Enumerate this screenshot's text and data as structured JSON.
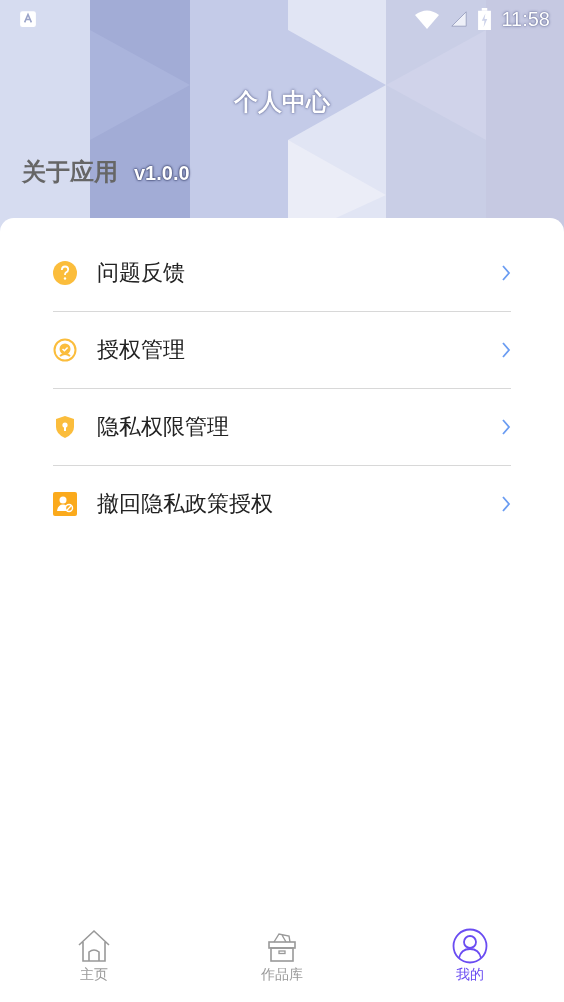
{
  "status_bar": {
    "time": "11:58"
  },
  "header": {
    "title": "个人中心",
    "about": "关于应用",
    "version": "v1.0.0"
  },
  "menu": [
    {
      "kind": "help",
      "label": "问题反馈"
    },
    {
      "kind": "badge",
      "label": "授权管理"
    },
    {
      "kind": "shield",
      "label": "隐私权限管理"
    },
    {
      "kind": "revoke",
      "label": "撤回隐私政策授权"
    }
  ],
  "tabs": [
    {
      "kind": "home",
      "label": "主页",
      "selected": false
    },
    {
      "kind": "box",
      "label": "作品库",
      "selected": false
    },
    {
      "kind": "user",
      "label": "我的",
      "selected": true
    }
  ]
}
